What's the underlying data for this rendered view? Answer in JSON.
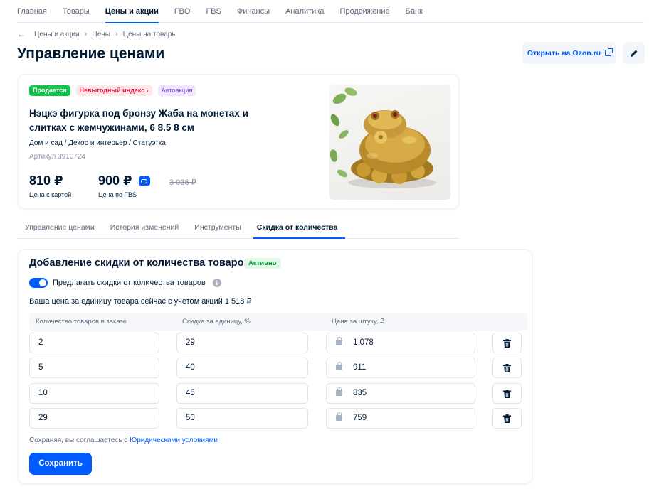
{
  "topnav": {
    "items": [
      "Главная",
      "Товары",
      "Цены и акции",
      "FBO",
      "FBS",
      "Финансы",
      "Аналитика",
      "Продвижение",
      "Банк"
    ],
    "active": "Цены и акции"
  },
  "breadcrumb": {
    "back_icon": "arrow-left-icon",
    "items": [
      "Цены и акции",
      "Цены",
      "Цены на товары"
    ]
  },
  "page": {
    "title": "Управление ценами",
    "open_ozon_label": "Открыть на Ozon.ru"
  },
  "product": {
    "badges": {
      "selling": "Продается",
      "unprofitable_index": "Невыгодный индекс",
      "autoaction": "Автоакция"
    },
    "name": "Нэцкэ фигурка под бронзу Жаба на монетах и слитках с жемчужинами, 6 8.5 8 см",
    "category": "Дом и сад / Декор и интерьер / Статуэтка",
    "article": "Артикул 3910724",
    "price_card": "810 ₽",
    "price_card_caption": "Цена с картой",
    "price_fbs": "900 ₽",
    "price_fbs_caption": "Цена по FBS",
    "price_old": "3 036 ₽"
  },
  "tabs": [
    "Управление ценами",
    "История изменений",
    "Инструменты",
    "Скидка от количества"
  ],
  "active_tab": "Скидка от количества",
  "discount": {
    "title": "Добавление скидки от количества товаров",
    "status": "Активно",
    "toggle_label": "Предлагать скидки от количества товаров",
    "toggle_on": true,
    "unit_price_text": "Ваша цена за единицу товара сейчас с учетом акций 1 518 ₽",
    "headers": {
      "quantity": "Количество товаров в заказе",
      "discount": "Скидка за единицу, %",
      "price": "Цена за штуку, ₽"
    },
    "rows": [
      {
        "quantity": "2",
        "discount": "29",
        "price": "1 078"
      },
      {
        "quantity": "5",
        "discount": "40",
        "price": "911"
      },
      {
        "quantity": "10",
        "discount": "45",
        "price": "835"
      },
      {
        "quantity": "29",
        "discount": "50",
        "price": "759"
      }
    ],
    "agree_prefix": "Сохраняя, вы соглашаетесь с ",
    "agree_link": "Юридическими условиями",
    "save_label": "Сохранить"
  },
  "colors": {
    "accent": "#005bff",
    "text": "#001a34",
    "green_badge": "#10c44c",
    "red_badge_text": "#e51c3e",
    "purple_badge_text": "#7b41d9"
  }
}
